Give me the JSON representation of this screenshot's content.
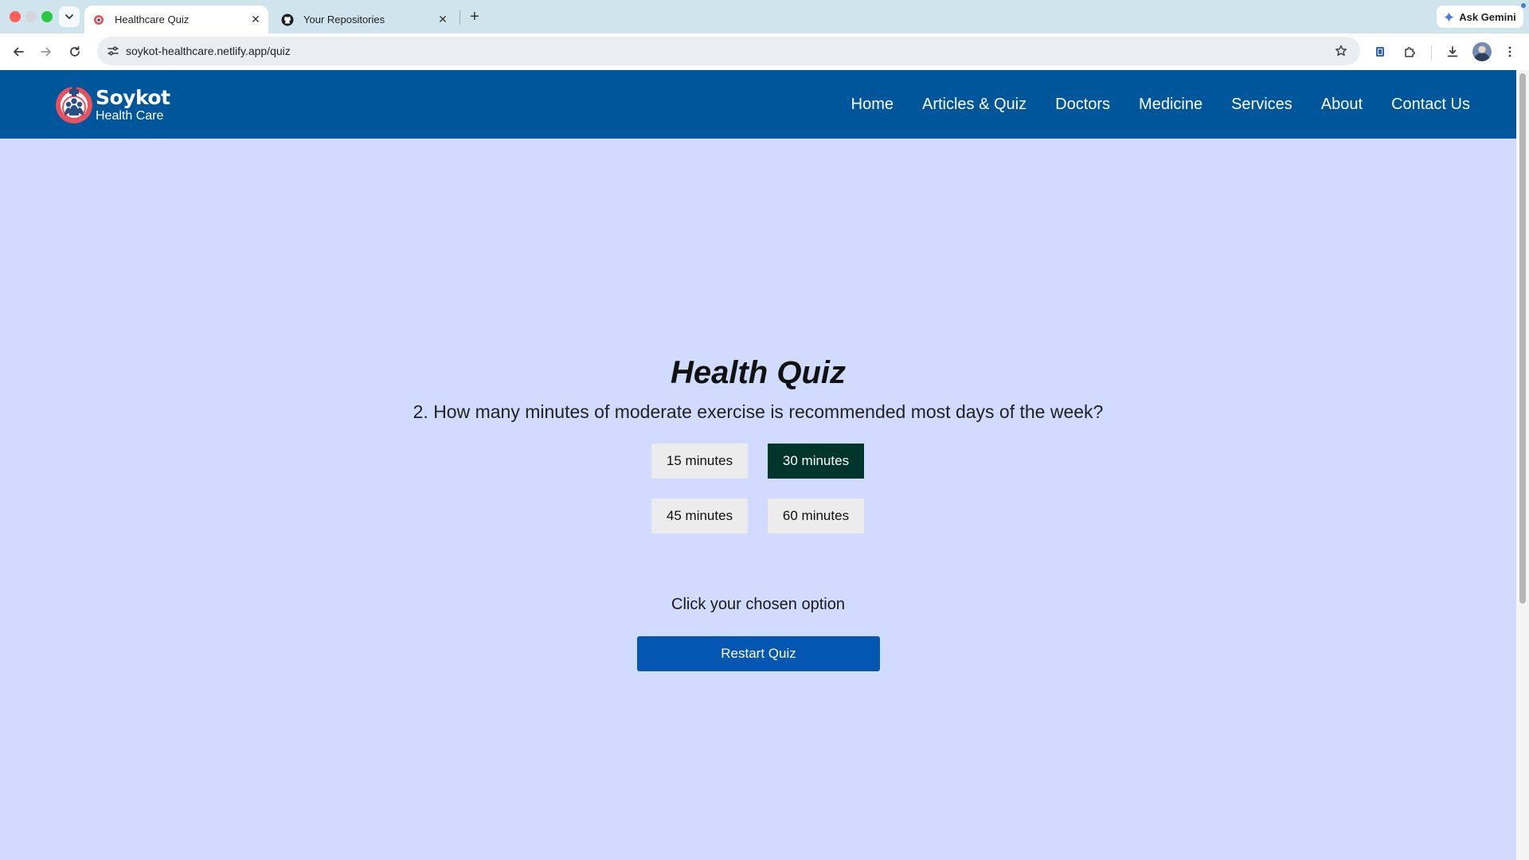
{
  "browser": {
    "tabs": [
      {
        "title": "Healthcare Quiz",
        "active": true
      },
      {
        "title": "Your Repositories",
        "active": false
      }
    ],
    "url": "soykot-healthcare.netlify.app/quiz",
    "ask_gemini_label": "Ask Gemini",
    "close_glyph": "✕",
    "new_tab_glyph": "+"
  },
  "site": {
    "brand": "Soykot",
    "brand_sub": "Health Care",
    "nav": [
      "Home",
      "Articles & Quiz",
      "Doctors",
      "Medicine",
      "Services",
      "About",
      "Contact Us"
    ]
  },
  "quiz": {
    "title": "Health Quiz",
    "question": "2. How many minutes of moderate exercise is recommended most days of the week?",
    "options": [
      {
        "label": "15 minutes",
        "selected": false
      },
      {
        "label": "30 minutes",
        "selected": true
      },
      {
        "label": "45 minutes",
        "selected": false
      },
      {
        "label": "60 minutes",
        "selected": false
      }
    ],
    "hint": "Click your chosen option",
    "restart_label": "Restart Quiz"
  },
  "colors": {
    "header_bg": "#00569a",
    "page_bg": "#d1dbfd",
    "selected_option_bg": "#00352b",
    "restart_bg": "#0356b1"
  },
  "icons": [
    "tab-search-icon",
    "back-arrow-icon",
    "forward-arrow-icon",
    "reload-icon",
    "site-settings-icon",
    "star-icon",
    "extension-icon",
    "puzzle-icon",
    "download-icon",
    "more-vertical-icon",
    "github-icon",
    "gemini-sparkle-icon"
  ]
}
